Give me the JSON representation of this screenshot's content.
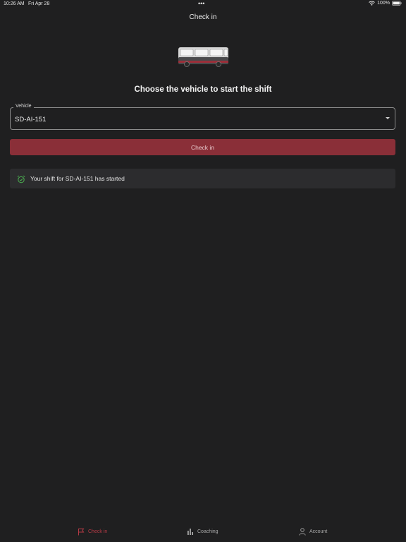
{
  "status_bar": {
    "time": "10:26 AM",
    "date": "Fri Apr 28",
    "dots": "•••",
    "battery": "100%"
  },
  "header": {
    "title": "Check in"
  },
  "main": {
    "prompt": "Choose the vehicle to start the shift",
    "vehicle_field": {
      "label": "Vehicle",
      "value": "SD-AI-151"
    },
    "checkin_button_label": "Check in",
    "alert": {
      "text": "Your shift for SD-AI-151 has started",
      "icon": "alarm-check-icon"
    }
  },
  "tab_bar": {
    "tabs": [
      {
        "label": "Check in",
        "icon": "flag-icon",
        "active": true
      },
      {
        "label": "Coaching",
        "icon": "bar-chart-icon",
        "active": false
      },
      {
        "label": "Account",
        "icon": "person-icon",
        "active": false
      }
    ]
  },
  "colors": {
    "background": "#1f1f20",
    "primary_button": "#8a2f38",
    "active_tab": "#b53a45",
    "success_icon": "#4caf50",
    "alert_background": "#2c2c2e"
  }
}
